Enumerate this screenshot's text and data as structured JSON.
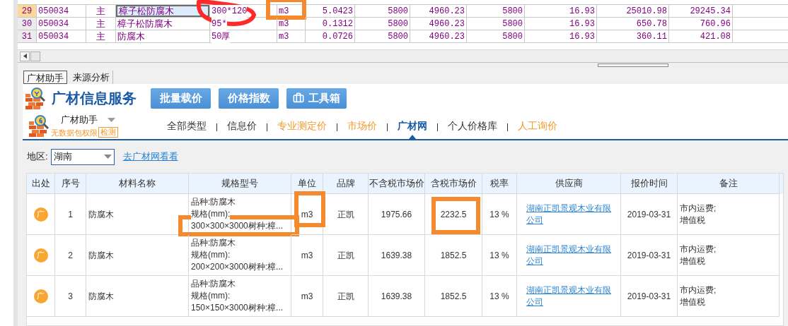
{
  "grid": {
    "rows": [
      {
        "number": "29",
        "selected": true,
        "code": "050034",
        "type": "主",
        "name": "樟子松防腐木",
        "spec": "300*120",
        "spec_scribbled": true,
        "unit": "m3",
        "unit_highlighted": true,
        "quantity": "5.0423",
        "column_8": "5800",
        "column_9": "4960.23",
        "column_10": "5800",
        "column_11": "16.93",
        "column_12": "25010.98",
        "column_13": "29245.34"
      },
      {
        "number": "30",
        "selected": false,
        "code": "050034",
        "type": "主",
        "name": "樟子松防腐木",
        "spec": "95*",
        "spec_scribbled": false,
        "unit": "m3",
        "unit_highlighted": false,
        "quantity": "0.1312",
        "column_8": "5800",
        "column_9": "4960.23",
        "column_10": "5800",
        "column_11": "16.93",
        "column_12": "650.78",
        "column_13": "760.96"
      },
      {
        "number": "31",
        "selected": false,
        "code": "050034",
        "type": "主",
        "name": "防腐木",
        "spec": "50厚",
        "spec_scribbled": false,
        "unit": "m3",
        "unit_highlighted": false,
        "quantity": "0.0726",
        "column_8": "5800",
        "column_9": "4960.23",
        "column_10": "5800",
        "column_11": "16.93",
        "column_12": "360.11",
        "column_13": "421.08"
      }
    ]
  },
  "panel_tabs": [
    {
      "label": "广材助手",
      "selected": true
    },
    {
      "label": "来源分析",
      "selected": false
    }
  ],
  "service": {
    "title": "广材信息服务",
    "buttons": [
      {
        "label": "批量载价",
        "kind": "plain"
      },
      {
        "label": "价格指数",
        "kind": "plain"
      },
      {
        "label": "工具箱",
        "kind": "toolbox"
      }
    ]
  },
  "account": {
    "name": "广材助手",
    "permission": "无数据包权限",
    "check_button": "检测"
  },
  "nav_tabs": [
    {
      "label": "全部类型",
      "selected": false,
      "color": "#333333"
    },
    {
      "label": "信息价",
      "selected": false,
      "color": "#333333"
    },
    {
      "label": "专业测定价",
      "selected": false,
      "color": "#f39a2c"
    },
    {
      "label": "市场价",
      "selected": false,
      "color": "#f39a2c"
    },
    {
      "label": "广材网",
      "selected": true,
      "color": "#1b5aa6"
    },
    {
      "label": "个人价格库",
      "selected": false,
      "color": "#333333"
    },
    {
      "label": "人工询价",
      "selected": false,
      "color": "#f39a2c"
    }
  ],
  "region": {
    "label": "地区:",
    "value": "湖南",
    "link": "去广材网看看"
  },
  "table": {
    "columns": [
      "出处",
      "序号",
      "材料名称",
      "规格型号",
      "单位",
      "品牌",
      "不含税市场价",
      "含税市场价",
      "税率",
      "供应商",
      "报价时间",
      "备注"
    ],
    "rows": [
      {
        "source": "广",
        "number": "1",
        "name": "防腐木",
        "spec": [
          "品种:防腐木",
          "规格(mm):",
          "300×300×3000树种:樟..."
        ],
        "spec_highlighted": true,
        "unit": "m3",
        "unit_highlighted": true,
        "brand": "正凯",
        "price_ex_tax": "1975.66",
        "price_incl_tax": "2232.5",
        "price_highlighted": true,
        "tax_rate": "13 %",
        "supplier": "湖南正凯景观木业有限公司",
        "date": "2019-03-31",
        "note": [
          "市内运费;",
          "增值税"
        ]
      },
      {
        "source": "广",
        "number": "2",
        "name": "防腐木",
        "spec": [
          "品种:防腐木",
          "规格(mm):",
          "200×200×3000树种:樟..."
        ],
        "spec_highlighted": false,
        "unit": "m3",
        "unit_highlighted": false,
        "brand": "正凯",
        "price_ex_tax": "1639.38",
        "price_incl_tax": "1852.5",
        "price_highlighted": false,
        "tax_rate": "13 %",
        "supplier": "湖南正凯景观木业有限公司",
        "date": "2019-03-31",
        "note": [
          "市内运费;",
          "增值税"
        ]
      },
      {
        "source": "广",
        "number": "3",
        "name": "防腐木",
        "spec": [
          "品种:防腐木",
          "规格(mm):",
          "150×150×3000树种:樟..."
        ],
        "spec_highlighted": false,
        "unit": "m3",
        "unit_highlighted": false,
        "brand": "正凯",
        "price_ex_tax": "1639.38",
        "price_incl_tax": "1852.5",
        "price_highlighted": false,
        "tax_rate": "13 %",
        "supplier": "湖南正凯景观木业有限公司",
        "date": "2019-03-31",
        "note": [
          "市内运费;",
          "增值税"
        ]
      }
    ]
  }
}
